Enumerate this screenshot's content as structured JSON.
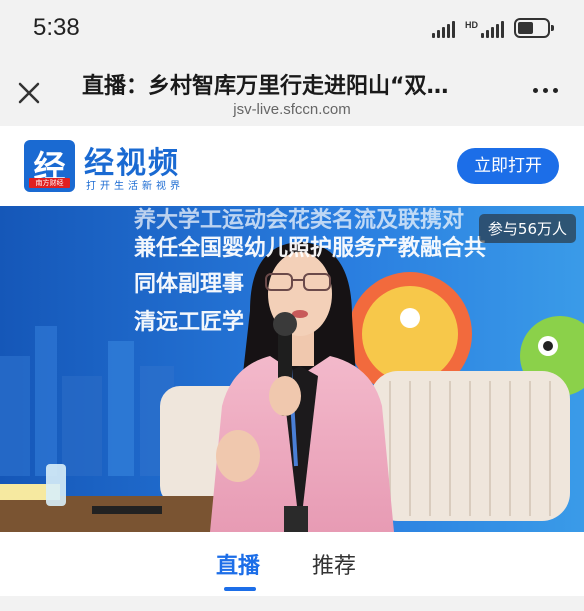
{
  "status_bar": {
    "time": "5:38",
    "signal_label": "HD",
    "battery_level": 0.55,
    "icons": [
      "cell-signal-icon",
      "cell-signal-hd-icon",
      "battery-icon"
    ]
  },
  "browser": {
    "title": "直播：乡村智库万里行走进阳山“双…",
    "url": "jsv-live.sfccn.com",
    "close_icon": "close-icon",
    "more_icon": "more-icon"
  },
  "app_banner": {
    "logo_char": "经",
    "logo_tag": "南方财经",
    "brand_name": "经视频",
    "slogan": "打开生活新视界",
    "open_button": "立即打开",
    "brand_color": "#1a6ad2",
    "button_color": "#1c6ee8"
  },
  "video": {
    "participants": "参与56万人",
    "background_lines": [
      "养大学工运动会花类名流及联携对",
      "兼任全国婴幼儿照护服务产教融合共",
      "同体副理事",
      "清远工匠学"
    ]
  },
  "tabs": {
    "live": "直播",
    "recommend": "推荐",
    "active": "直播",
    "active_color": "#1c6ee8"
  }
}
